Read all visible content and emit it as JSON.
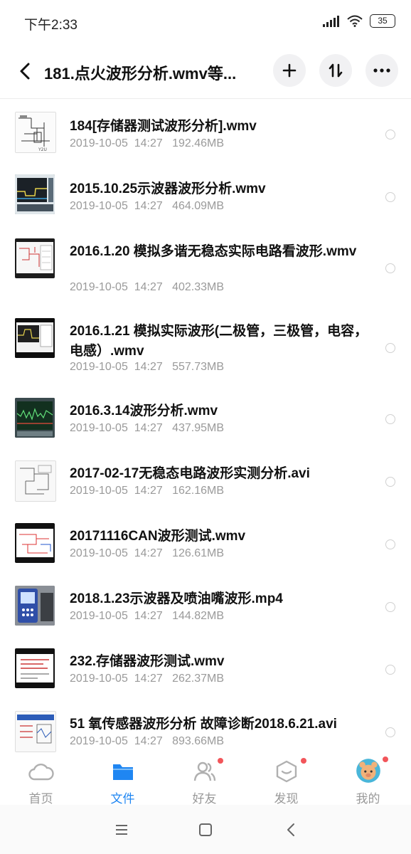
{
  "status_bar": {
    "time": "下午2:33",
    "battery": "35",
    "icons": [
      "signal-icon",
      "wifi-icon",
      "battery-icon"
    ]
  },
  "header": {
    "back_icon": "chevron-left-icon",
    "title": "181.点火波形分析.wmv等...",
    "add_icon": "plus-icon",
    "sort_icon": "sort-icon",
    "more_icon": "more-icon"
  },
  "files": [
    {
      "name": "184[存储器测试波形分析].wmv",
      "meta": "2019-10-05  14:27   192.46MB"
    },
    {
      "name": "2015.10.25示波器波形分析.wmv",
      "meta": "2019-10-05  14:27   464.09MB"
    },
    {
      "name": "2016.1.20  模拟多谐无稳态实际电路看波形.wmv",
      "meta": "2019-10-05  14:27   402.33MB"
    },
    {
      "name": "2016.1.21  模拟实际波形(二极管，三极管，电容，电感）.wmv",
      "meta": "2019-10-05  14:27   557.73MB"
    },
    {
      "name": "2016.3.14波形分析.wmv",
      "meta": "2019-10-05  14:27   437.95MB"
    },
    {
      "name": "2017-02-17无稳态电路波形实测分析.avi",
      "meta": "2019-10-05  14:27   162.16MB"
    },
    {
      "name": "20171116CAN波形测试.wmv",
      "meta": "2019-10-05  14:27   126.61MB"
    },
    {
      "name": "2018.1.23示波器及喷油嘴波形.mp4",
      "meta": "2019-10-05  14:27   144.82MB"
    },
    {
      "name": "232.存储器波形测试.wmv",
      "meta": "2019-10-05  14:27   262.37MB"
    },
    {
      "name": "51 氧传感器波形分析 故障诊断2018.6.21.avi",
      "meta": "2019-10-05  14:27   893.66MB"
    }
  ],
  "tabs": [
    {
      "label": "首页",
      "icon": "home-cloud-icon",
      "active": false,
      "dot": false
    },
    {
      "label": "文件",
      "icon": "folder-icon",
      "active": true,
      "dot": false
    },
    {
      "label": "好友",
      "icon": "friends-icon",
      "active": false,
      "dot": true
    },
    {
      "label": "发现",
      "icon": "discover-icon",
      "active": false,
      "dot": true
    },
    {
      "label": "我的",
      "icon": "avatar-icon",
      "active": false,
      "dot": true
    }
  ],
  "colors": {
    "accent": "#1f86f2",
    "dot": "#f2555a",
    "meta": "#9a9a9a"
  },
  "nav_bar": [
    "menu-icon",
    "home-square-icon",
    "back-icon"
  ]
}
